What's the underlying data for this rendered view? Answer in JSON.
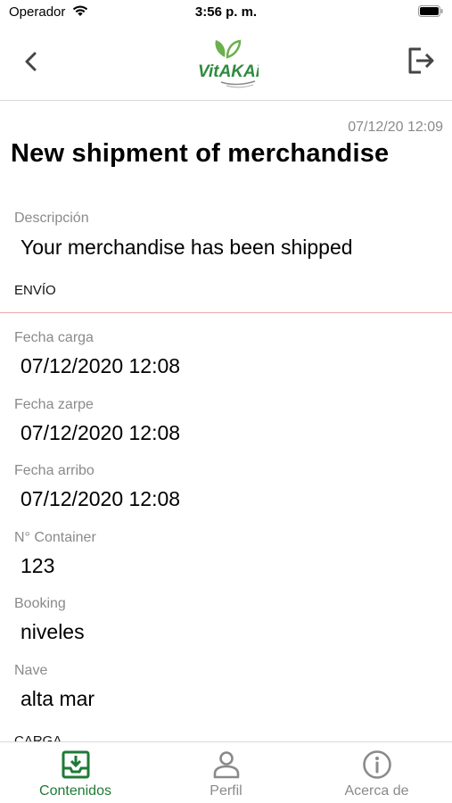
{
  "status_bar": {
    "carrier": "Operador",
    "time": "3:56 p. m."
  },
  "nav": {
    "logo_text": "VitAKAi",
    "back_icon": "chevron-left-icon",
    "logout_icon": "logout-icon"
  },
  "detail": {
    "date": "07/12/20 12:09",
    "title": "New shipment of merchandise",
    "description_label": "Descripción",
    "description_value": "Your merchandise has been shipped"
  },
  "envio": {
    "header": "ENVÍO",
    "fields": [
      {
        "label": "Fecha carga",
        "value": "07/12/2020 12:08"
      },
      {
        "label": "Fecha zarpe",
        "value": "07/12/2020 12:08"
      },
      {
        "label": "Fecha arribo",
        "value": "07/12/2020 12:08"
      },
      {
        "label": "N° Container",
        "value": "123"
      },
      {
        "label": "Booking",
        "value": "niveles"
      },
      {
        "label": "Nave",
        "value": "alta mar"
      }
    ]
  },
  "next_section": {
    "header": "CARGA"
  },
  "tabs": [
    {
      "label": "Contenidos",
      "icon": "inbox-download-icon",
      "active": true
    },
    {
      "label": "Perfil",
      "icon": "user-icon",
      "active": false
    },
    {
      "label": "Acerca de",
      "icon": "info-icon",
      "active": false
    }
  ],
  "colors": {
    "accent": "#1e7a35",
    "inactive": "#8a8a8a",
    "divider": "#f0a7a7",
    "logo_green": "#5aa33a"
  }
}
